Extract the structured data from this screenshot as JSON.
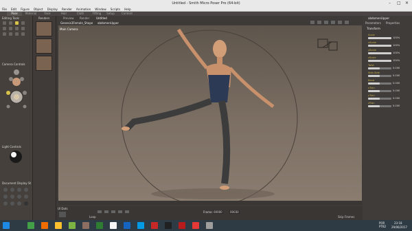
{
  "window": {
    "title": "Untitled - Smith Micro Poser Pro (64-bit)"
  },
  "menu": [
    "File",
    "Edit",
    "Figure",
    "Object",
    "Display",
    "Render",
    "Animation",
    "Window",
    "Scripts",
    "Help"
  ],
  "rooms": [
    "Pose",
    "Material",
    "Face",
    "Hair",
    "Cloth",
    "Fitting",
    "Setup",
    "Content"
  ],
  "left": {
    "editing_tools": "Editing Tools",
    "camera_controls": "Camera Controls",
    "light_controls": "Light Controls",
    "document_display": "Document Display St"
  },
  "library": {
    "title": "Renders"
  },
  "document": {
    "tabs": [
      "Preview",
      "Render",
      "Untitled"
    ],
    "breadcrumb_figure": "Genesis3Female_Shape",
    "breadcrumb_part": "abdomenUpper",
    "camera_label": "Main Camera",
    "frame_label": "Frame:",
    "frame_value": "00000",
    "frame_total": "00030",
    "loop_label": "Loop",
    "skip_frames": "Skip Frames",
    "ui_dots": "UI Dots"
  },
  "params": {
    "title": "abdomenUpper",
    "tabs": [
      "Parameters",
      "Properties"
    ],
    "group": "Transform",
    "sliders": [
      {
        "label": "Scale",
        "value": "100%",
        "fill": 1.0
      },
      {
        "label": "xScale",
        "value": "100%",
        "fill": 1.0
      },
      {
        "label": "yScale",
        "value": "100%",
        "fill": 1.0
      },
      {
        "label": "zScale",
        "value": "100%",
        "fill": 1.0
      },
      {
        "label": "Twist",
        "value": "0.000",
        "fill": 0.5
      },
      {
        "label": "Side-Side",
        "value": "0.000",
        "fill": 0.5
      },
      {
        "label": "Bend",
        "value": "0.000",
        "fill": 0.5
      },
      {
        "label": "xTran",
        "value": "0.000",
        "fill": 0.5
      },
      {
        "label": "yTran",
        "value": "0.000",
        "fill": 0.5
      },
      {
        "label": "zTran",
        "value": "0.000",
        "fill": 0.5
      }
    ]
  },
  "taskbar": {
    "lang": "POR PTB2",
    "time": "23:18",
    "date": "29/06/2017"
  }
}
